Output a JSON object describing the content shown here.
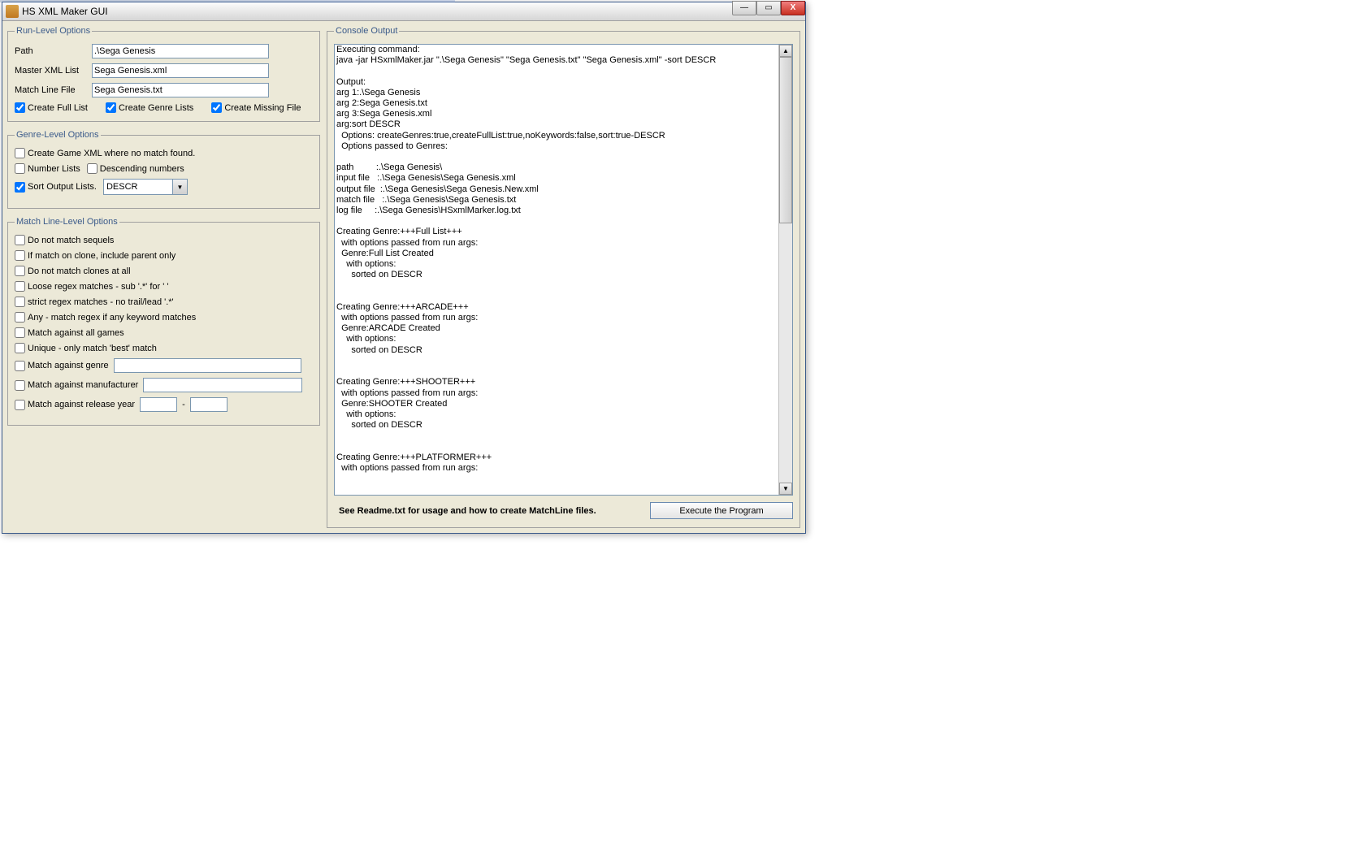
{
  "window": {
    "title": "HS XML Maker GUI"
  },
  "runLevel": {
    "legend": "Run-Level Options",
    "pathLabel": "Path",
    "pathValue": ".\\Sega Genesis",
    "masterXmlLabel": "Master XML List",
    "masterXmlValue": "Sega Genesis.xml",
    "matchLineLabel": "Match Line File",
    "matchLineValue": "Sega Genesis.txt",
    "createFullList": "Create Full List",
    "createGenreLists": "Create Genre Lists",
    "createMissingFile": "Create Missing File"
  },
  "genreLevel": {
    "legend": "Genre-Level Options",
    "createGameXml": "Create Game XML where no match found.",
    "numberLists": "Number Lists",
    "descendingNumbers": "Descending numbers",
    "sortOutputLists": "Sort Output Lists.",
    "sortSelected": "DESCR"
  },
  "matchLineLevel": {
    "legend": "Match Line-Level Options",
    "noMatchSequels": "Do not match sequels",
    "cloneParentOnly": "If match on clone, include parent only",
    "noMatchClones": "Do not match clones at all",
    "looseRegex": "Loose regex matches - sub '.*' for ' '",
    "strictRegex": "strict regex matches - no trail/lead '.*'",
    "anyMatch": "Any - match regex if any keyword matches",
    "matchAllGames": "Match against all games",
    "uniqueBest": "Unique - only match 'best' match",
    "matchGenre": "Match against genre",
    "matchManufacturer": "Match against manufacturer",
    "matchReleaseYear": "Match against release year",
    "yearSep": "-"
  },
  "console": {
    "legend": "Console Output",
    "text": "Executing command:\njava -jar HSxmlMaker.jar \".\\Sega Genesis\" \"Sega Genesis.txt\" \"Sega Genesis.xml\" -sort DESCR\n\nOutput:\narg 1:.\\Sega Genesis\narg 2:Sega Genesis.txt\narg 3:Sega Genesis.xml\narg:sort DESCR\n  Options: createGenres:true,createFullList:true,noKeywords:false,sort:true-DESCR\n  Options passed to Genres:\n\npath         :.\\Sega Genesis\\\ninput file   :.\\Sega Genesis\\Sega Genesis.xml\noutput file  :.\\Sega Genesis\\Sega Genesis.New.xml\nmatch file   :.\\Sega Genesis\\Sega Genesis.txt\nlog file     :.\\Sega Genesis\\HSxmlMarker.log.txt\n\nCreating Genre:+++Full List+++\n  with options passed from run args:\n  Genre:Full List Created\n    with options:\n      sorted on DESCR\n\n\nCreating Genre:+++ARCADE+++\n  with options passed from run args:\n  Genre:ARCADE Created\n    with options:\n      sorted on DESCR\n\n\nCreating Genre:+++SHOOTER+++\n  with options passed from run args:\n  Genre:SHOOTER Created\n    with options:\n      sorted on DESCR\n\n\nCreating Genre:+++PLATFORMER+++\n  with options passed from run args:"
  },
  "footer": {
    "readme": "See Readme.txt for usage and how to create MatchLine files.",
    "executeBtn": "Execute the Program"
  }
}
